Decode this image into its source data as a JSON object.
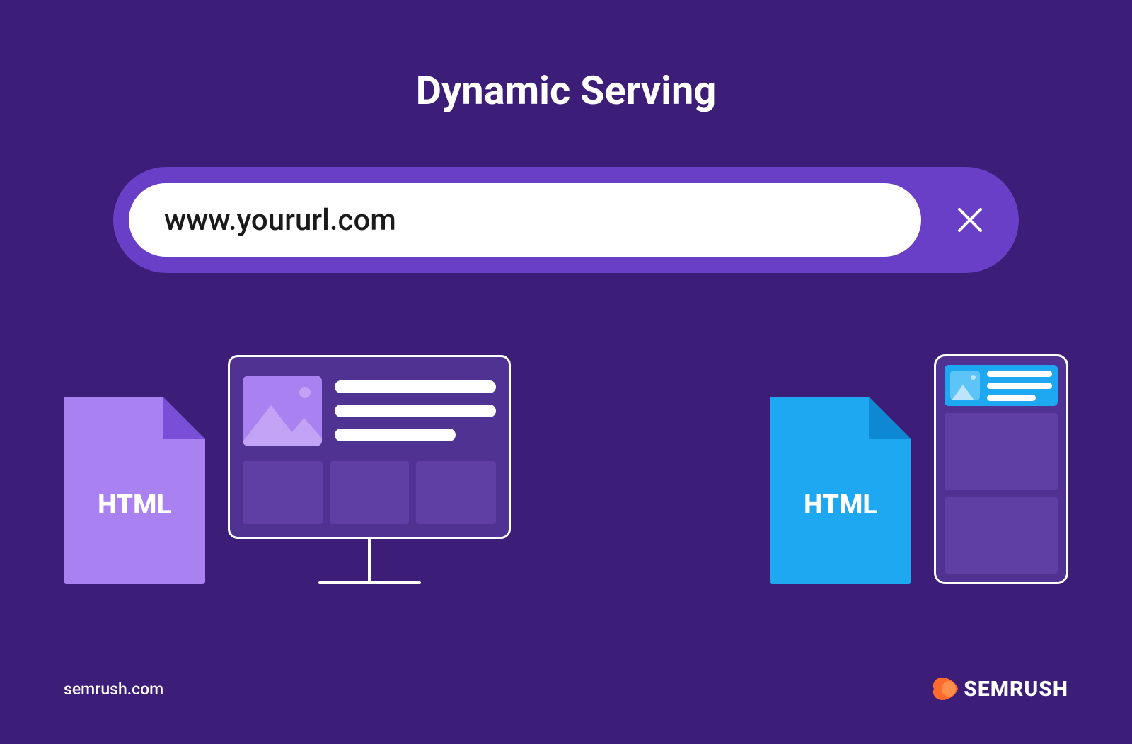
{
  "title": "Dynamic Serving",
  "search": {
    "value": "www.yoururl.com"
  },
  "files": {
    "desktop_label": "HTML",
    "mobile_label": "HTML"
  },
  "footer": {
    "site": "semrush.com",
    "brand": "SEMRUSH"
  }
}
